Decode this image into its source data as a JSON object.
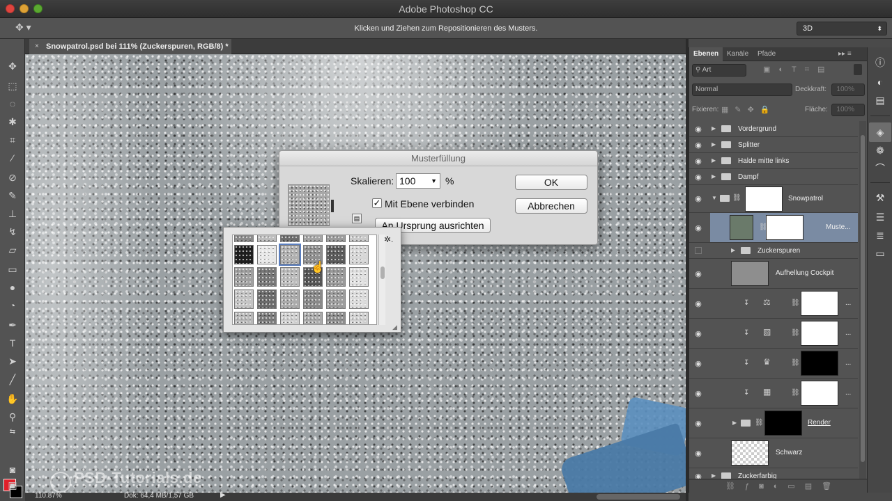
{
  "app": {
    "title": "Adobe Photoshop CC"
  },
  "options_bar": {
    "hint": "Klicken und Ziehen zum Repositionieren des Musters.",
    "workspace": "3D"
  },
  "document": {
    "tab_title": "Snowpatrol.psd bei 111% (Zuckerspuren, RGB/8) *",
    "close_glyph": "×"
  },
  "status_bar": {
    "zoom": "110.87%",
    "doc_size": "Dok: 64,4 MB/1,57 GB"
  },
  "watermark": {
    "text": "PSD-Tutorials.de"
  },
  "dialog": {
    "title": "Musterfüllung",
    "scale_label": "Skalieren:",
    "scale_value": "100",
    "scale_unit": "%",
    "link_label": "Mit Ebene verbinden",
    "link_checked": true,
    "snap_button": "An Ursprung ausrichten",
    "ok_button": "OK",
    "cancel_button": "Abbrechen"
  },
  "layers_panel": {
    "tabs": [
      {
        "label": "Ebenen"
      },
      {
        "label": "Kanäle"
      },
      {
        "label": "Pfade"
      }
    ],
    "filter_label": "Art",
    "blend_mode": "Normal",
    "opacity_label": "Deckkraft:",
    "opacity_value": "100%",
    "lock_label": "Fixieren:",
    "fill_label": "Fläche:",
    "fill_value": "100%",
    "layers": [
      {
        "name": "Vordergrund",
        "type": "group"
      },
      {
        "name": "Splitter",
        "type": "group"
      },
      {
        "name": "Halde mitte links",
        "type": "group"
      },
      {
        "name": "Dampf",
        "type": "group"
      },
      {
        "name": "Snowpatrol",
        "type": "group-open"
      },
      {
        "name": "Muste...",
        "type": "fill",
        "selected": true
      },
      {
        "name": "Zuckerspuren",
        "type": "group",
        "hidden": true
      },
      {
        "name": "Aufhellung Cockpit",
        "type": "layer"
      },
      {
        "name": "...",
        "type": "adjustment",
        "icon": "balance-icon"
      },
      {
        "name": "...",
        "type": "adjustment",
        "icon": "curves-icon"
      },
      {
        "name": "...",
        "type": "adjustment",
        "icon": "levels-icon"
      },
      {
        "name": "...",
        "type": "adjustment",
        "icon": "gradient-map-icon"
      },
      {
        "name": "Render",
        "type": "group-masked"
      },
      {
        "name": "Schwarz",
        "type": "layer-transparent"
      },
      {
        "name": "Zuckerfarbig",
        "type": "group"
      }
    ]
  },
  "colors": {
    "foreground": "#e0202a",
    "background": "#000000",
    "selection": "#7a8ba3"
  }
}
